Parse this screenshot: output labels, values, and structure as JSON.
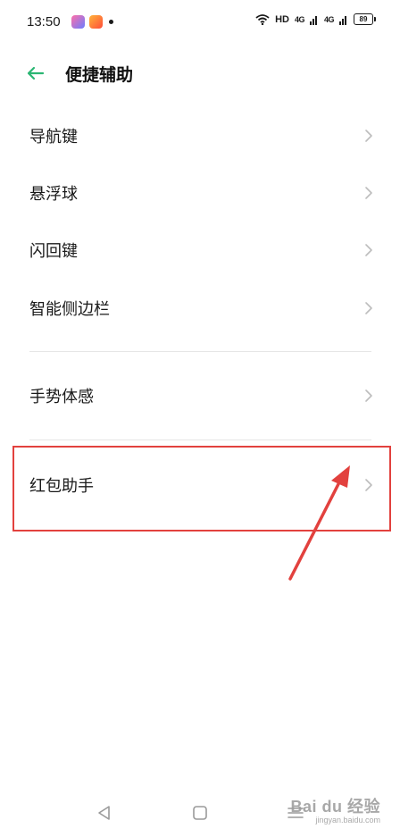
{
  "status_bar": {
    "time": "13:50",
    "network_label": "HD",
    "signal_1": "4G",
    "signal_2": "4G",
    "battery": "89"
  },
  "header": {
    "title": "便捷辅助",
    "back_icon": "arrow-left-icon"
  },
  "menu_items": [
    {
      "label": "导航键"
    },
    {
      "label": "悬浮球"
    },
    {
      "label": "闪回键"
    },
    {
      "label": "智能侧边栏"
    },
    {
      "label": "手势体感"
    },
    {
      "label": "红包助手"
    }
  ],
  "nav_bar": {
    "icons": [
      "back-triangle-icon",
      "home-square-icon",
      "menu-lines-icon"
    ]
  },
  "watermark": {
    "main": "Bai du 经验",
    "sub": "jingyan.baidu.com"
  },
  "colors": {
    "accent": "#2bb673",
    "highlight": "#e2413e",
    "chevron": "#bdbdbd",
    "divider": "#e6e6e6"
  }
}
